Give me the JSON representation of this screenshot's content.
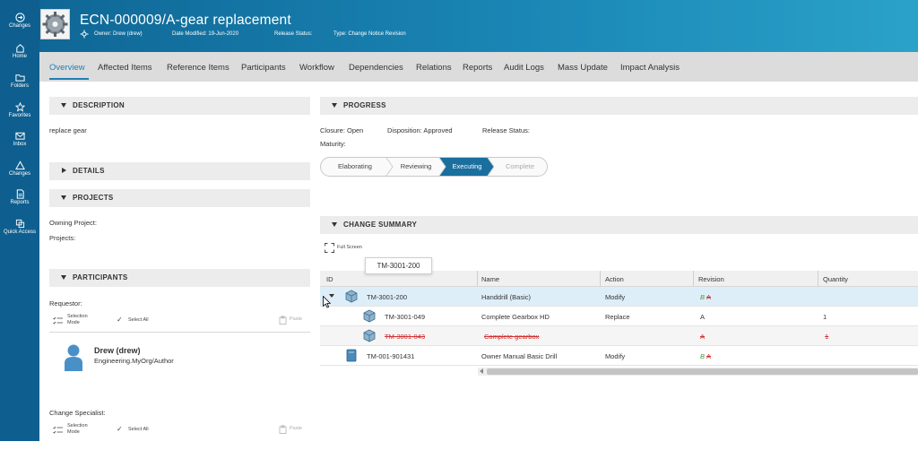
{
  "nav": {
    "items": [
      {
        "label": "Changes",
        "icon": "changes-icon"
      },
      {
        "label": "Home",
        "icon": "home-icon"
      },
      {
        "label": "Folders",
        "icon": "folder-icon"
      },
      {
        "label": "Favorites",
        "icon": "star-icon"
      },
      {
        "label": "Inbox",
        "icon": "inbox-icon"
      },
      {
        "label": "Changes",
        "icon": "triangle-icon"
      },
      {
        "label": "Reports",
        "icon": "report-icon"
      },
      {
        "label": "Quick Access",
        "icon": "quick-access-icon"
      }
    ]
  },
  "header": {
    "title": "ECN-000009/A-gear replacement",
    "owner": "Owner: Drew (drew)",
    "modified": "Date Modified: 19-Jun-2020",
    "release": "Release Status:",
    "type": "Type: Change Notice Revision"
  },
  "tabs": [
    "Overview",
    "Affected Items",
    "Reference Items",
    "Participants",
    "Workflow",
    "Dependencies",
    "Relations",
    "Reports",
    "Audit Logs",
    "Mass Update",
    "Impact Analysis"
  ],
  "description": {
    "title": "DESCRIPTION",
    "text": "replace gear"
  },
  "details": {
    "title": "DETAILS"
  },
  "projects": {
    "title": "PROJECTS",
    "owning": "Owning Project:",
    "projects": "Projects:"
  },
  "participants": {
    "title": "PARTICIPANTS",
    "requestor_label": "Requestor:",
    "selection_mode": "Selection\nMode",
    "selection_line1": "Selection",
    "selection_line2": "Mode",
    "select_all": "Select All",
    "paste": "Paste",
    "user_name": "Drew (drew)",
    "user_org": "Engineering.MyOrg/Author",
    "specialist_label": "Change Specialist:"
  },
  "progress": {
    "title": "PROGRESS",
    "closure": "Closure: Open",
    "disposition": "Disposition: Approved",
    "release": "Release Status:",
    "maturity": "Maturity:",
    "steps": [
      "Elaborating",
      "Reviewing",
      "Executing",
      "Complete"
    ],
    "active_step": 2
  },
  "summary": {
    "title": "CHANGE SUMMARY",
    "full_screen": "Full Screen",
    "tooltip": "TM-3001-200",
    "columns": [
      "ID",
      "Name",
      "Action",
      "Revision",
      "Quantity"
    ],
    "rows": [
      {
        "id": "TM-3001-200",
        "name": "Handdrill (Basic)",
        "action": "Modify",
        "rev_new": "B",
        "rev_old": "A",
        "qty": ""
      },
      {
        "id": "TM-3001-049",
        "name": "Complete Gearbox HD",
        "action": "Replace",
        "rev": "A",
        "qty": "1"
      },
      {
        "id": "TM-3001-043",
        "name": "Complete gearbox",
        "action": "",
        "rev": "A",
        "qty": "1"
      },
      {
        "id": "TM-001-901431",
        "name": "Owner Manual Basic Drill",
        "action": "Modify",
        "rev_new": "B",
        "rev_old": "A",
        "qty": ""
      }
    ]
  },
  "colors": {
    "accent": "#1f7fb4",
    "rail": "#0e5f8f",
    "active_step": "#1a6f9f",
    "removed": "#d03030",
    "new_rev": "#3c9d3c"
  }
}
